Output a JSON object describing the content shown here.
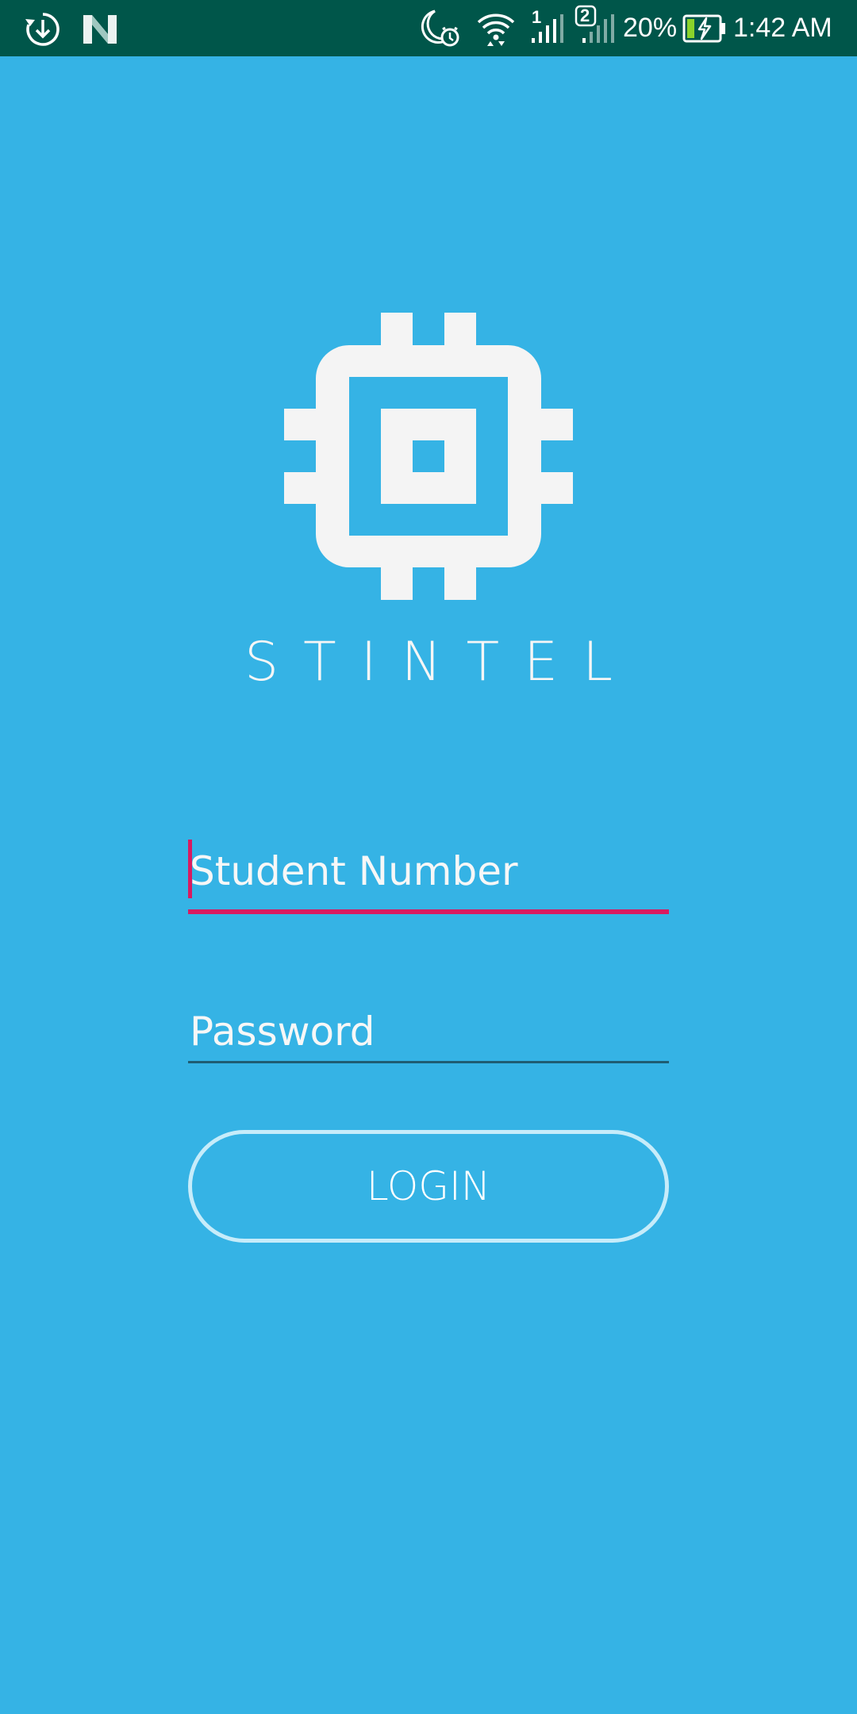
{
  "status_bar": {
    "background": "#00564a",
    "left_icons": [
      "sync-download-icon",
      "n-notification-icon"
    ],
    "right_icons": [
      "do-not-disturb-alarm-icon",
      "wifi-icon",
      "signal-sim1-icon",
      "signal-sim2-icon",
      "battery-charging-icon"
    ],
    "sim1_label": "1",
    "sim2_label": "2",
    "battery_percent": "20%",
    "time": "1:42 AM"
  },
  "app": {
    "background": "#35b3e5",
    "logo_icon": "chip-icon",
    "name": "STINTEL"
  },
  "form": {
    "student_number": {
      "placeholder": "Student Number",
      "value": "",
      "focused": true,
      "accent": "#d81b60"
    },
    "password": {
      "placeholder": "Password",
      "value": ""
    },
    "login_label": "LOGIN"
  }
}
